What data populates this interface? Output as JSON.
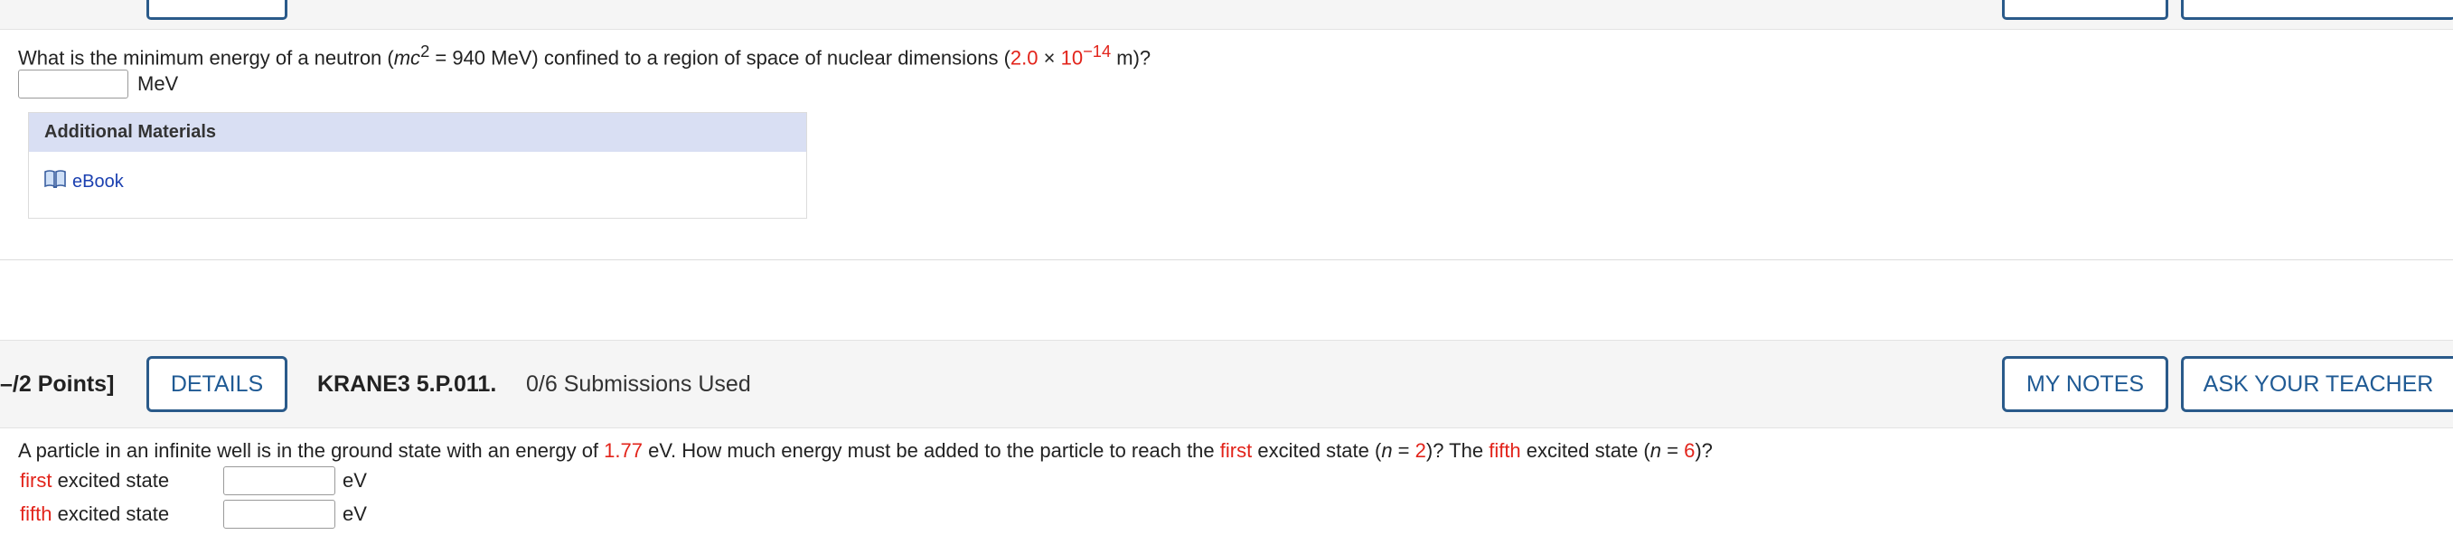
{
  "q1": {
    "before": "What is the minimum energy of a neutron (",
    "mc": "mc",
    "sup2": "2",
    "middle": " = 940 MeV) confined to a region of space of nuclear dimensions (",
    "val": "2.0",
    "times": " × ",
    "ten": "10",
    "exp": "−14",
    "after": " m)?",
    "answer_value": "",
    "unit": "MeV"
  },
  "additional": {
    "title": "Additional Materials",
    "ebook_label": "eBook"
  },
  "problem2": {
    "points": "–/2 Points]",
    "details_label": "DETAILS",
    "code": "KRANE3 5.P.011.",
    "submissions": "0/6 Submissions Used",
    "notes_label": "MY NOTES",
    "ask_label": "ASK YOUR TEACHER",
    "text_1": "A particle in an infinite well is in the ground state with an energy of ",
    "energy": "1.77",
    "text_2": " eV. How much energy must be added to the particle to reach the ",
    "first_word": "first",
    "text_3": " excited state  (",
    "n_var": "n",
    "text_eq": " = ",
    "n_first": "2",
    "text_4": ")?  The ",
    "fifth_word": "fifth",
    "text_5": " excited state  (",
    "n_fifth": "6",
    "text_6": ")?",
    "rows": [
      {
        "label_red": "first",
        "label_rest": " excited state",
        "value": "",
        "unit": "eV"
      },
      {
        "label_red": "fifth",
        "label_rest": " excited state",
        "value": "",
        "unit": "eV"
      }
    ]
  }
}
